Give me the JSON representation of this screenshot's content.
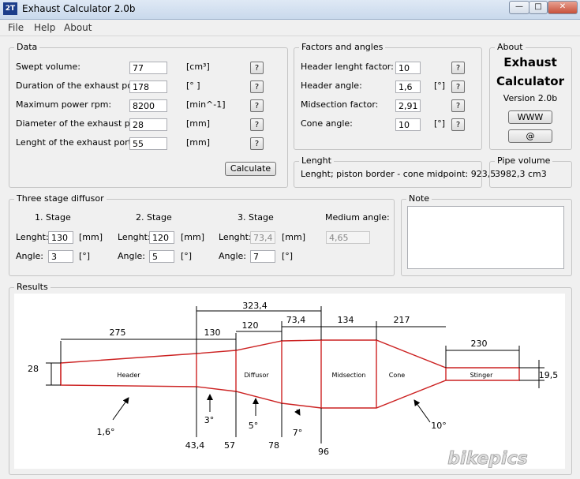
{
  "window": {
    "title": "Exhaust Calculator 2.0b",
    "icon_text": "2T"
  },
  "menu": [
    "File",
    "Help",
    "About"
  ],
  "data_group": {
    "title": "Data",
    "rows": [
      {
        "label": "Swept volume:",
        "value": "77",
        "unit": "[cm³]"
      },
      {
        "label": "Duration of the exhaust port:",
        "value": "178",
        "unit": "[° ]"
      },
      {
        "label": "Maximum power rpm:",
        "value": "8200",
        "unit": "[min^-1]"
      },
      {
        "label": "Diameter of the exhaust port:",
        "value": "28",
        "unit": "[mm]"
      },
      {
        "label": "Lenght of the exhaust port:",
        "value": "55",
        "unit": "[mm]"
      }
    ],
    "help_label": "?",
    "calculate_label": "Calculate"
  },
  "factors_group": {
    "title": "Factors and angles",
    "rows": [
      {
        "label": "Header lenght factor:",
        "value": "10",
        "unit": ""
      },
      {
        "label": "Header angle:",
        "value": "1,6",
        "unit": "[°]"
      },
      {
        "label": "Midsection factor:",
        "value": "2,91",
        "unit": ""
      },
      {
        "label": "Cone angle:",
        "value": "10",
        "unit": "[°]"
      }
    ]
  },
  "about_group": {
    "title": "About",
    "line1": "Exhaust",
    "line2": "Calculator",
    "version": "Version 2.0b",
    "www_label": "WWW",
    "mail_label": "@"
  },
  "lenght_group": {
    "title": "Lenght",
    "text": "Lenght; piston border - cone midpoint:  923,5"
  },
  "pipe_group": {
    "title": "Pipe volume",
    "text": "3982,3 cm3"
  },
  "diffusor_group": {
    "title": "Three stage diffusor",
    "lenght_label": "Lenght:",
    "angle_label": "Angle:",
    "mm_unit": "[mm]",
    "deg_unit": "[°]",
    "stages": [
      {
        "title": "1. Stage",
        "lenght": "130",
        "angle": "3"
      },
      {
        "title": "2. Stage",
        "lenght": "120",
        "angle": "5"
      },
      {
        "title": "3. Stage",
        "lenght": "73,4",
        "angle": "7"
      }
    ],
    "medium_title": "Medium angle:",
    "medium_value": "4,65"
  },
  "note_group": {
    "title": "Note"
  },
  "results_group": {
    "title": "Results",
    "diagram": {
      "dimensions_top": [
        "275",
        "130",
        "120",
        "73,4",
        "134",
        "217",
        "230"
      ],
      "dimension_span": "323,4",
      "section_labels": [
        "Header",
        "Diffusor",
        "Midsection",
        "Cone",
        "Stinger"
      ],
      "left_diameter": "28",
      "right_diameter": "19,5",
      "bottom_values": [
        "43,4",
        "57",
        "78",
        "96"
      ],
      "angles": [
        "1,6°",
        "3°",
        "5°",
        "7°",
        "10°"
      ]
    }
  },
  "watermark": "bikepics",
  "colors": {
    "pipe": "#cc2222",
    "titlebar": "#c9d9ec"
  }
}
